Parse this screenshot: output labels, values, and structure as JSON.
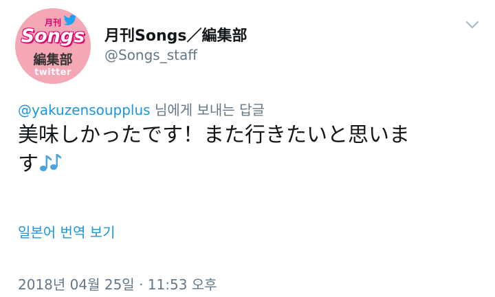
{
  "avatar": {
    "top_text": "月刊",
    "brand": "Songs",
    "sub_text": "編集部",
    "bottom_text": "twitter"
  },
  "user": {
    "display_name": "月刊Songs／編集部",
    "handle": "@Songs_staff"
  },
  "reply": {
    "mention": "@yakuzensoupplus",
    "suffix": "님에게 보내는 답글"
  },
  "tweet": {
    "text_line1": "美味しかったです！また行きたいと思いま",
    "text_line2": "す",
    "emoji": "music-notes-icon"
  },
  "translate_label": "일본어 번역 보기",
  "timestamp": "2018년 04월 25일 · 11:53 오후",
  "colors": {
    "link": "#1b95e0",
    "secondary": "#657786",
    "avatar_bg": "#f4a7b5",
    "avatar_accent": "#e2006a"
  }
}
